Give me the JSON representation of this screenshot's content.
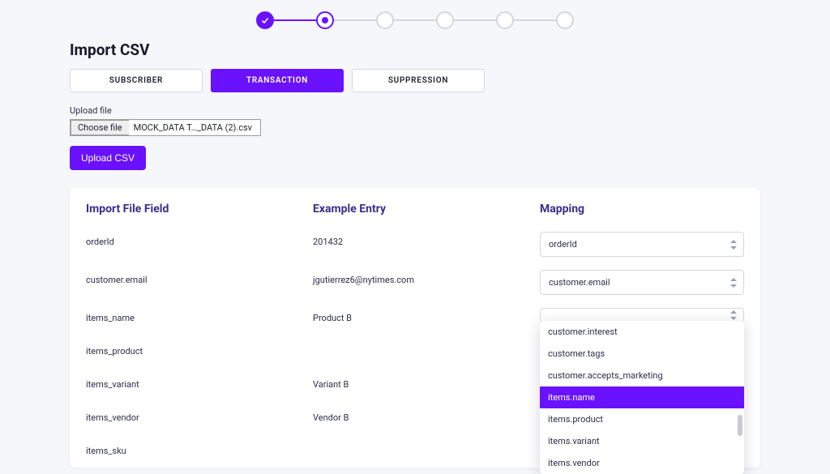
{
  "page": {
    "title": "Import CSV"
  },
  "stepper": {
    "steps": [
      {
        "state": "done"
      },
      {
        "state": "current"
      },
      {
        "state": "pending"
      },
      {
        "state": "pending"
      },
      {
        "state": "pending"
      },
      {
        "state": "pending"
      }
    ]
  },
  "tabs": {
    "items": [
      {
        "label": "SUBSCRIBER",
        "active": false
      },
      {
        "label": "TRANSACTION",
        "active": true
      },
      {
        "label": "SUPPRESSION",
        "active": false
      }
    ]
  },
  "upload": {
    "label": "Upload file",
    "choose_label": "Choose file",
    "file_name": "MOCK_DATA T…_DATA (2).csv",
    "button_label": "Upload CSV"
  },
  "columns": {
    "field": "Import File Field",
    "example": "Example Entry",
    "mapping": "Mapping"
  },
  "rows": [
    {
      "field": "orderId",
      "example": "201432",
      "mapping": "orderId"
    },
    {
      "field": "customer.email",
      "example": "jgutierrez6@nytimes.com",
      "mapping": "customer.email"
    },
    {
      "field": "items_name",
      "example": "Product B",
      "mapping": ""
    },
    {
      "field": "items_product",
      "example": "",
      "mapping": ""
    },
    {
      "field": "items_variant",
      "example": "Variant B",
      "mapping": ""
    },
    {
      "field": "items_vendor",
      "example": "Vendor B",
      "mapping": ""
    },
    {
      "field": "items_sku",
      "example": "",
      "mapping": ""
    }
  ],
  "dropdown": {
    "open_for_row": 2,
    "options": [
      {
        "label": "customer.interest",
        "highlight": false
      },
      {
        "label": "customer.tags",
        "highlight": false
      },
      {
        "label": "customer.accepts_marketing",
        "highlight": false
      },
      {
        "label": "items.name",
        "highlight": true
      },
      {
        "label": "items.product",
        "highlight": false
      },
      {
        "label": "items.variant",
        "highlight": false
      },
      {
        "label": "items.vendor",
        "highlight": false
      }
    ]
  },
  "colors": {
    "accent": "#6a11ff",
    "bg": "#f6f7fb",
    "border": "#d6d6e0",
    "text_muted": "#2d2f45",
    "heading_purple": "#3d2c8d"
  }
}
